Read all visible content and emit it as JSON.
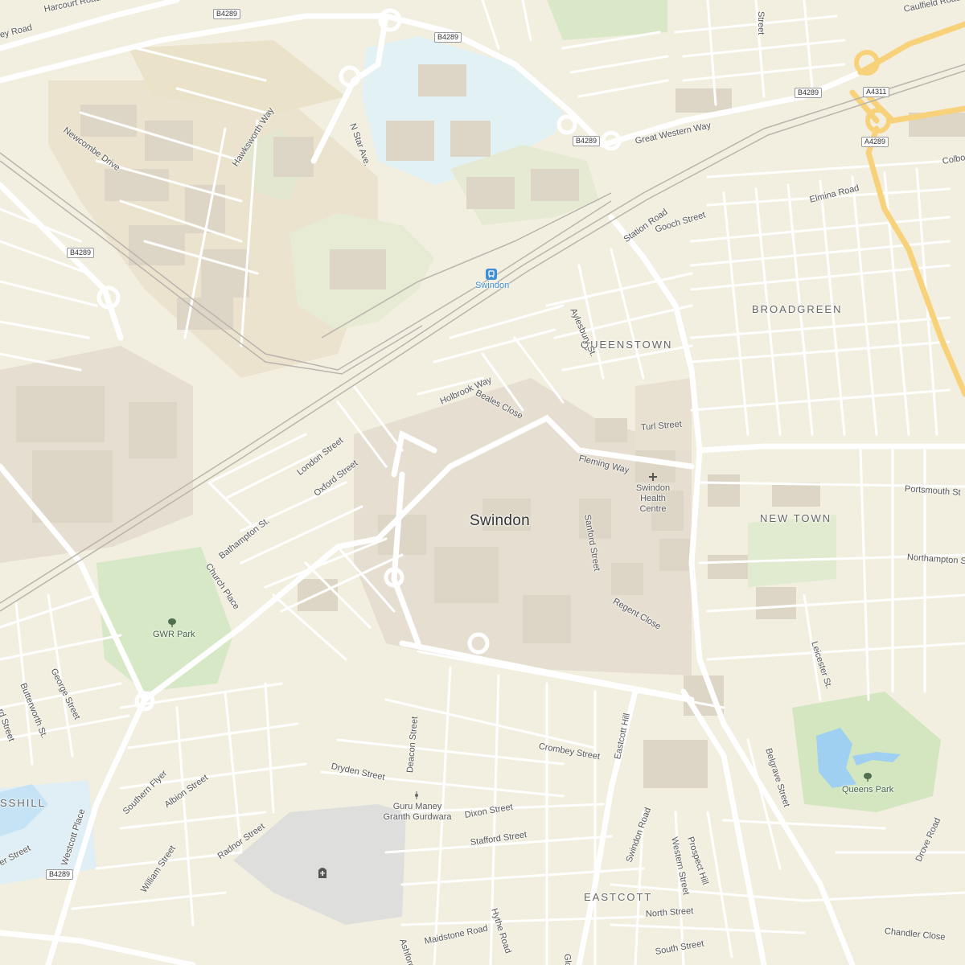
{
  "map": {
    "colors": {
      "background": "#f2efe0",
      "industrial": "#ebe3cd",
      "commercial": "#e5ddd0",
      "park": "#d7e8c6",
      "water": "#9fd0f2",
      "hospital_zone": "#e2f1f4",
      "road": "#ffffff",
      "major_road": "#f8d27a",
      "railway": "#b9b4ad",
      "building": "#ddd6c6"
    },
    "city_label": "Swindon",
    "districts": [
      "BROADGREEN",
      "QUEENSTOWN",
      "NEW TOWN",
      "EASTCOTT",
      "SSHILL"
    ],
    "streets": [
      "Harcourt Road",
      "ey Road",
      "Caulfield Road",
      "Great Western Way",
      "N Star Ave.",
      "Hawksworth Way",
      "Newcombe Drive",
      "Station Road",
      "Gooch Street",
      "Elmina Road",
      "Colbo",
      "Aylesbury St.",
      "Beales Close",
      "Holbrook Way",
      "Turl Street",
      "Fleming Way",
      "London Street",
      "Oxford Street",
      "Bathampton St.",
      "Church Place",
      "Sanford Street",
      "Regent Close",
      "Portsmouth St",
      "Northampton S",
      "Leicester St.",
      "Belgrave Street",
      "George Street",
      "Butterworth St.",
      "rd Street",
      "Crombey Street",
      "Eastcott Hill",
      "Deacon Street",
      "Dryden Street",
      "Dixon Street",
      "Stafford Street",
      "Albion Street",
      "Southern Flyer",
      "Westcott Place",
      "Radnor Street",
      "William Street",
      "Swindon Road",
      "Western Street",
      "Prospect Hill",
      "North Street",
      "South Street",
      "Drove Road",
      "Chandler Close",
      "Maidstone Road",
      "Hythe Road",
      "Ashford Ro",
      "Globe",
      "er Street",
      "Street"
    ],
    "route_shields": [
      "B4289",
      "B4289",
      "B4289",
      "B4289",
      "B4289",
      "A4311",
      "A4289",
      "B4289"
    ],
    "pois": [
      {
        "name": "Swindon",
        "icon": "train-station-icon"
      },
      {
        "name": "Swindon Health Centre",
        "icon": "medical-cross-icon"
      },
      {
        "name": "GWR Park",
        "icon": "tree-icon"
      },
      {
        "name": "Queens Park",
        "icon": "tree-icon"
      },
      {
        "name": "Guru Maney Granth Gurdwara",
        "icon": "place-of-worship-icon"
      },
      {
        "name": "",
        "icon": "cemetery-icon"
      }
    ]
  }
}
